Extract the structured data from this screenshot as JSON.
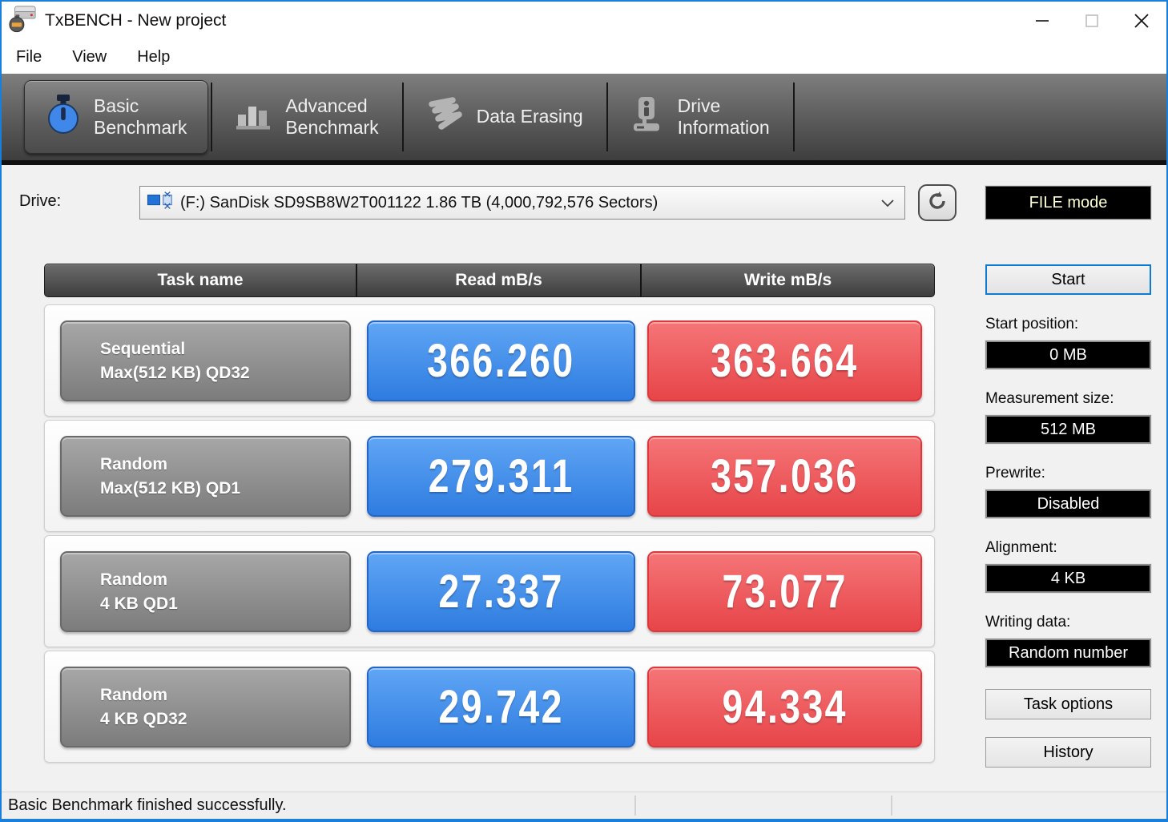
{
  "window": {
    "title": "TxBENCH - New project"
  },
  "menu": {
    "file": "File",
    "view": "View",
    "help": "Help"
  },
  "toolbar": {
    "tabs": [
      {
        "line1": "Basic",
        "line2": "Benchmark",
        "selected": true
      },
      {
        "line1": "Advanced",
        "line2": "Benchmark",
        "selected": false
      },
      {
        "line1": "Data Erasing",
        "line2": "",
        "selected": false
      },
      {
        "line1": "Drive",
        "line2": "Information",
        "selected": false
      }
    ]
  },
  "drive": {
    "label": "Drive:",
    "selected_option": "(F:) SanDisk SD9SB8W2T001122  1.86 TB (4,000,792,576 Sectors)",
    "file_mode_label": "FILE mode"
  },
  "benchmark_table": {
    "headers": [
      "Task name",
      "Read mB/s",
      "Write mB/s"
    ],
    "rows": [
      {
        "task_line1": "Sequential",
        "task_line2": "Max(512 KB) QD32",
        "read": "366.260",
        "write": "363.664"
      },
      {
        "task_line1": "Random",
        "task_line2": "Max(512 KB) QD1",
        "read": "279.311",
        "write": "357.036"
      },
      {
        "task_line1": "Random",
        "task_line2": "4 KB QD1",
        "read": "27.337",
        "write": "73.077"
      },
      {
        "task_line1": "Random",
        "task_line2": "4 KB QD32",
        "read": "29.742",
        "write": "94.334"
      }
    ]
  },
  "side_panel": {
    "start_button": "Start",
    "fields": [
      {
        "label": "Start position:",
        "value": "0 MB"
      },
      {
        "label": "Measurement size:",
        "value": "512 MB"
      },
      {
        "label": "Prewrite:",
        "value": "Disabled"
      },
      {
        "label": "Alignment:",
        "value": "4 KB"
      },
      {
        "label": "Writing data:",
        "value": "Random number"
      }
    ],
    "task_options_button": "Task options",
    "history_button": "History"
  },
  "status_bar": {
    "message": "Basic Benchmark finished successfully."
  },
  "colors": {
    "accent_blue": "#1a7edb",
    "read_box_blue": "#3a86e8",
    "write_box_red": "#ee5458",
    "task_box_gray": "#8d8d8d",
    "value_panel_black": "#000000"
  }
}
